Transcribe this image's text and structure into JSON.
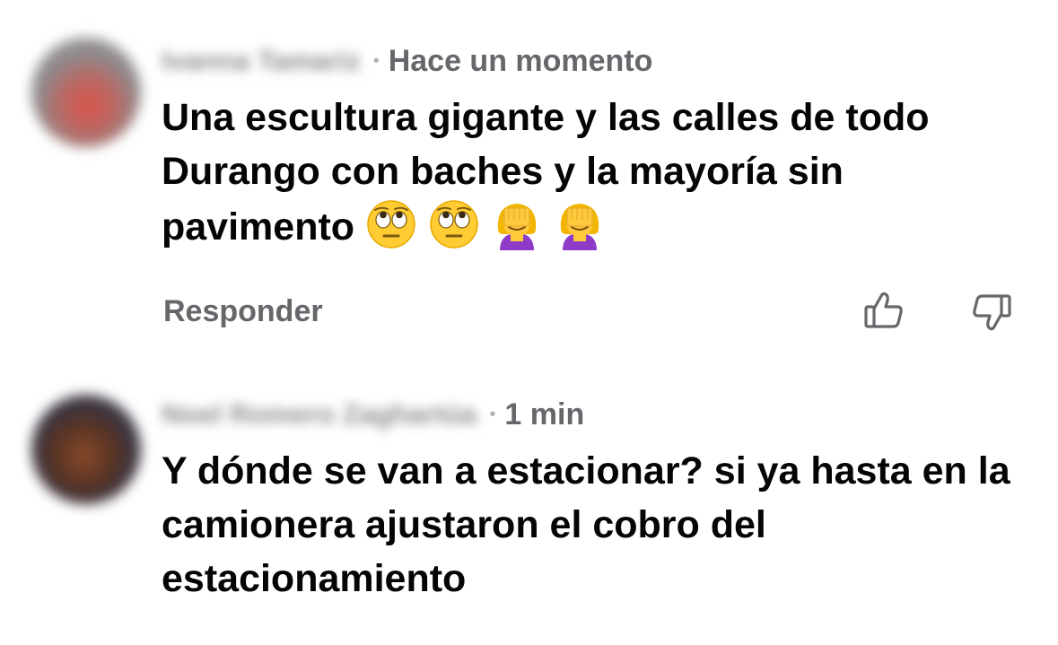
{
  "comments": [
    {
      "author": "Ivanna Tamariz",
      "timestamp": "Hace un momento",
      "text": "Una escultura gigante y las calles de todo Durango con baches y la mayoría sin pavimento",
      "emojis": [
        "face-with-rolling-eyes",
        "face-with-rolling-eyes",
        "woman-facepalming",
        "woman-facepalming"
      ],
      "reply_label": "Responder"
    },
    {
      "author": "Noel Romero Zaghartúa",
      "timestamp": "1 min",
      "text": "Y dónde se van a estacionar? si ya hasta en la camionera ajustaron el cobro del estacionamiento"
    }
  ],
  "icons": {
    "like": "thumbs-up-outline-icon",
    "dislike": "thumbs-down-outline-icon"
  },
  "colors": {
    "text": "#050505",
    "secondary": "#65676b",
    "icon": "#65676b"
  }
}
